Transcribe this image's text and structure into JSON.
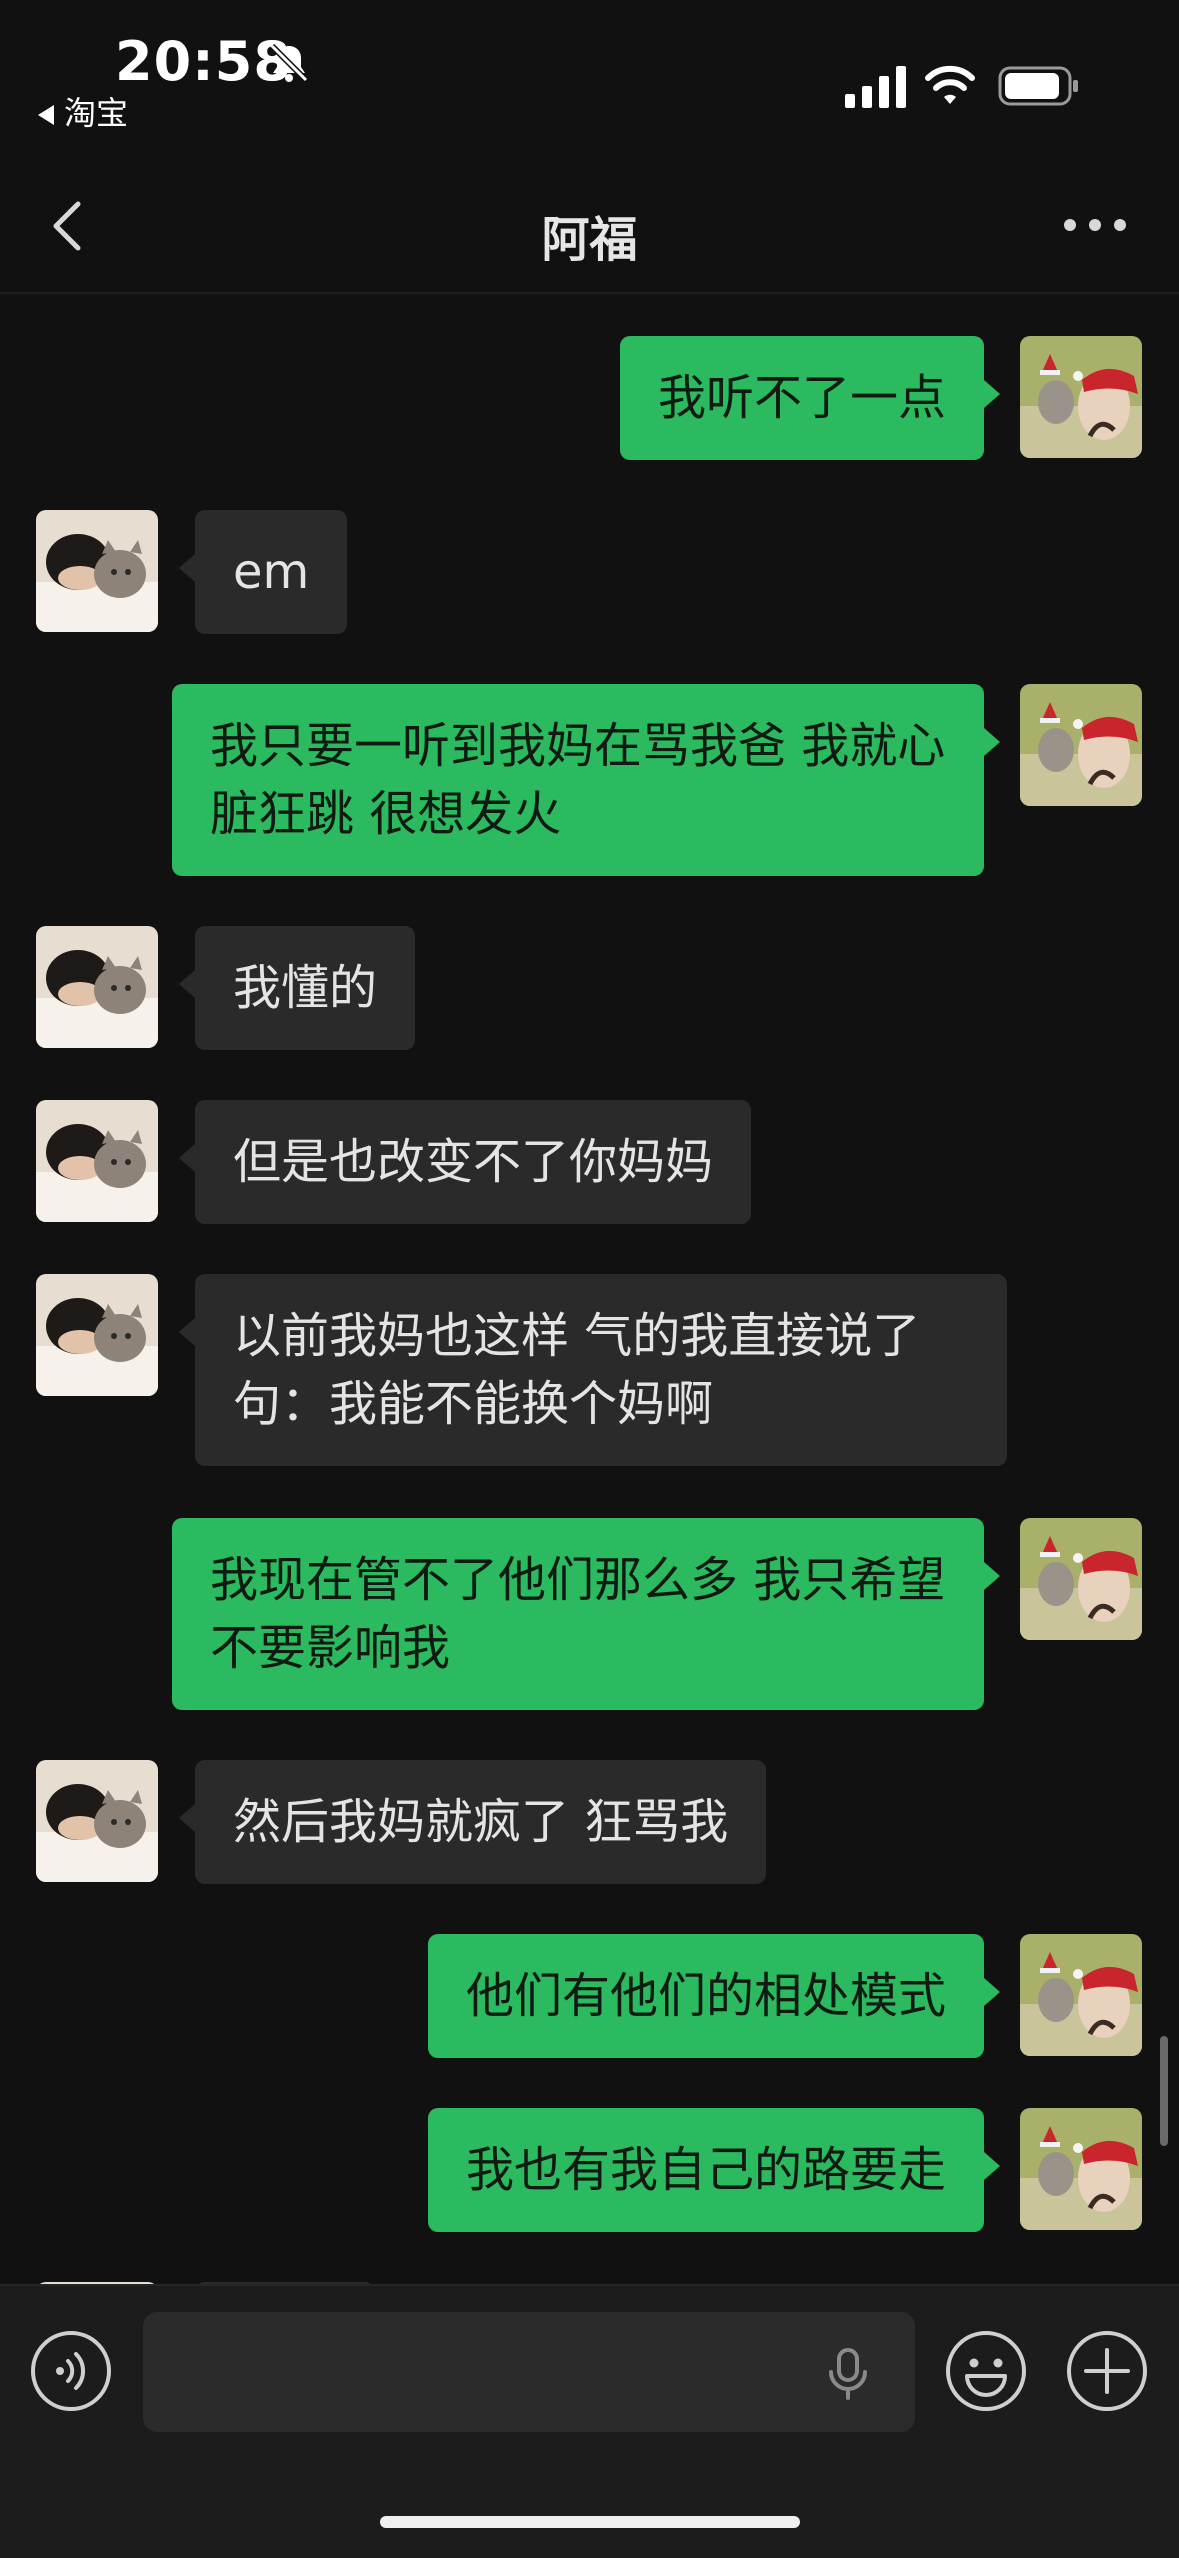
{
  "status_bar": {
    "time": "20:58",
    "back_app": "淘宝",
    "icons": [
      "bell-slash-icon",
      "signal-icon",
      "wifi-icon",
      "battery-icon"
    ]
  },
  "nav": {
    "title": "阿福",
    "back_icon": "chevron-left-icon",
    "more_icon": "more-dots-icon"
  },
  "colors": {
    "background": "#111111",
    "self_bubble": "#2bba5f",
    "other_bubble": "#2a2a2a"
  },
  "messages": [
    {
      "sender": "self",
      "text": "我听不了一点"
    },
    {
      "sender": "other",
      "text": "em"
    },
    {
      "sender": "self",
      "text": "我只要一听到我妈在骂我爸 我就心脏狂跳 很想发火"
    },
    {
      "sender": "other",
      "text": "我懂的"
    },
    {
      "sender": "other",
      "text": "但是也改变不了你妈妈"
    },
    {
      "sender": "other",
      "text": "以前我妈也这样 气的我直接说了句：我能不能换个妈啊"
    },
    {
      "sender": "self",
      "text": "我现在管不了他们那么多 我只希望不要影响我"
    },
    {
      "sender": "other",
      "text": "然后我妈就疯了 狂骂我"
    },
    {
      "sender": "self",
      "text": "他们有他们的相处模式"
    },
    {
      "sender": "self",
      "text": "我也有我自己的路要走"
    }
  ],
  "input_bar": {
    "voice_icon": "voice-mode-icon",
    "mic_icon": "microphone-icon",
    "emoji_icon": "emoji-icon",
    "plus_icon": "plus-icon"
  }
}
